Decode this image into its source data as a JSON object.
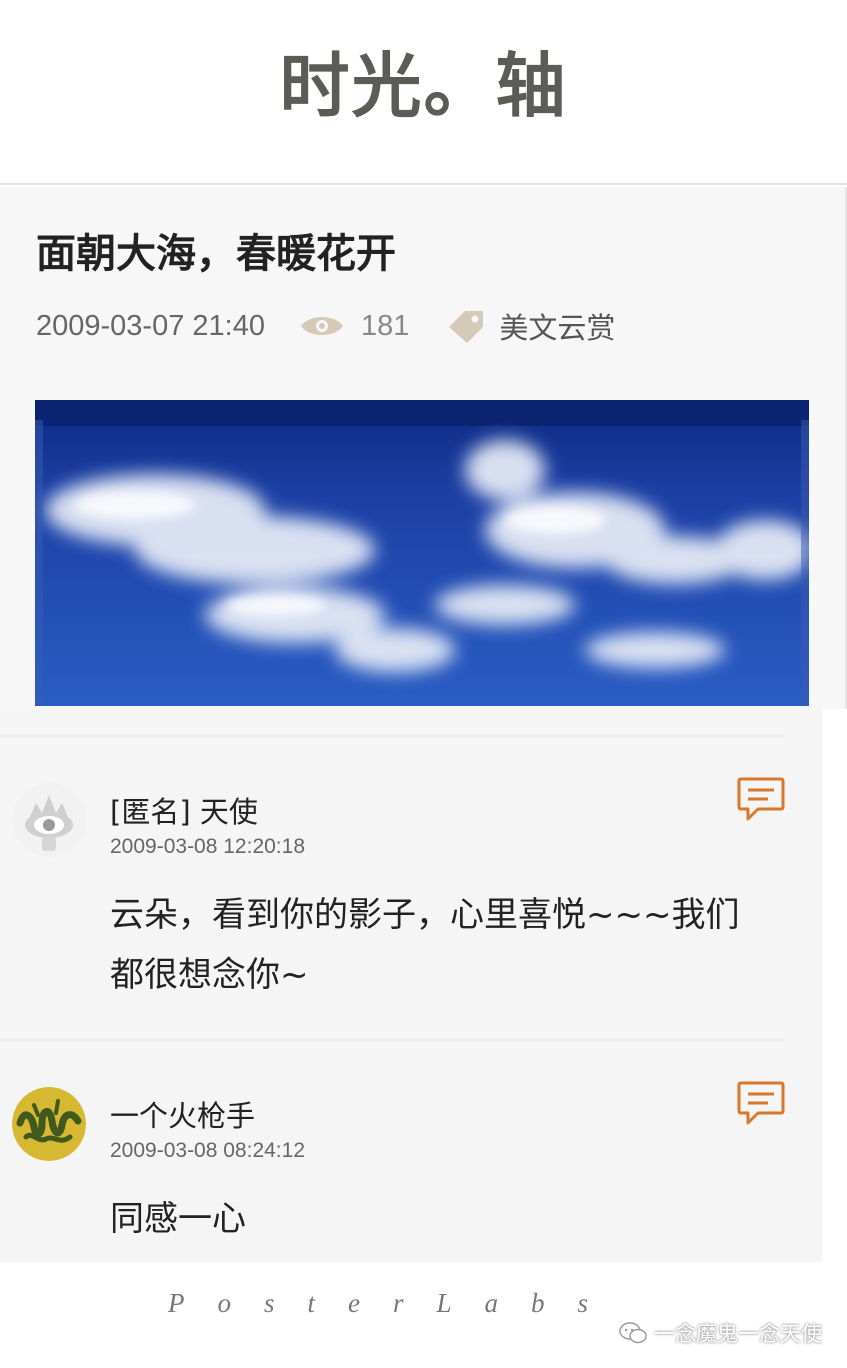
{
  "header": {
    "title": "时光。轴"
  },
  "post": {
    "title": "面朝大海，春暖花开",
    "date": "2009-03-07 21:40",
    "views": "181",
    "tag": "美文云赏"
  },
  "comments": [
    {
      "name": "[匿名] 天使",
      "time": "2009-03-08 12:20:18",
      "body": "云朵，看到你的影子，心里喜悦~~~我们都很想念你~"
    },
    {
      "name": "一个火枪手",
      "time": "2009-03-08 08:24:12",
      "body": "同感一心"
    }
  ],
  "footer": {
    "brand": "PosterLabs",
    "watermark": "一念魔鬼一念天使"
  },
  "colors": {
    "accent_orange": "#d9772b",
    "icon_tan": "#d5cab8",
    "sky_blue": "#1d43a6"
  },
  "icons": [
    "eye-icon",
    "tag-icon",
    "comment-reply-icon",
    "weibo-avatar-icon",
    "wechat-icon"
  ]
}
